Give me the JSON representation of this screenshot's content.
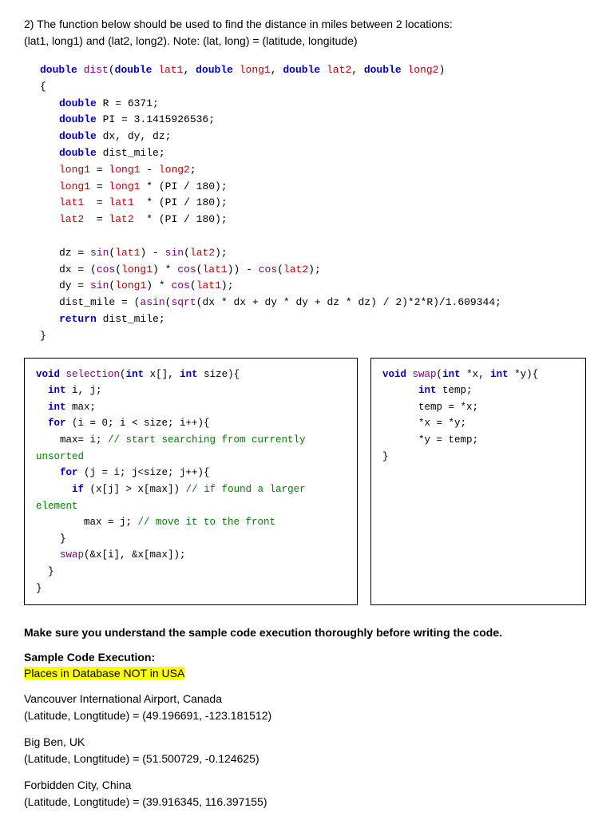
{
  "intro": {
    "number": "2)",
    "text": "  The function below should be used to find the distance in miles between 2 locations:",
    "note": "(lat1, long1) and (lat2, long2). Note: (lat, long) = (latitude, longitude)"
  },
  "dist_function": {
    "signature": "double dist(double lat1, double long1, double lat2, double long2)",
    "body_lines": [
      "double R = 6371;",
      "double PI = 3.1415926536;",
      "double dx, dy, dz;",
      "double dist_mile;",
      "long1 = long1 - long2;",
      "long1 = long1 * (PI / 180);",
      "lat1  = lat1  * (PI / 180);",
      "lat2  = lat2  * (PI / 180);",
      "",
      "dz = sin(lat1) - sin(lat2);",
      "dx = (cos(long1) * cos(lat1)) - cos(lat2);",
      "dy = sin(long1) * cos(lat1);",
      "dist_mile = (asin(sqrt(dx * dx + dy * dy + dz * dz) / 2)*2*R)/1.609344;",
      "return dist_mile;"
    ]
  },
  "selection_function": {
    "lines": [
      "void selection(int x[], int size){",
      "   int i, j;",
      "   int max;",
      "   for (i = 0; i < size; i++){",
      "      max= i; // start searching from currently unsorted",
      "      for (j = i; j<size; j++){",
      "         if (x[j] > x[max]) // if found a larger element",
      "            max = j; // move it to the front",
      "      }",
      "      swap(&x[i], &x[max]);",
      "   }",
      "}"
    ],
    "comment1": "// start searching from currently unsorted",
    "comment2": "// if found a larger element",
    "comment3": "// move it to the front"
  },
  "swap_function": {
    "lines": [
      "void swap(int *x, int *y){",
      "      int temp;",
      "      temp = *x;",
      "      *x = *y;",
      "      *y = temp;",
      "}"
    ]
  },
  "instruction": "Make sure you understand the sample code execution thoroughly before writing the code.",
  "sample_label": "Sample Code Execution:",
  "highlighted_text": "Places in Database NOT in USA",
  "places": [
    {
      "name": "Vancouver International Airport, Canada",
      "coords": "(Latitude, Longtitude) = (49.196691, -123.181512)"
    },
    {
      "name": "Big Ben, UK",
      "coords": "(Latitude, Longtitude) = (51.500729, -0.124625)"
    },
    {
      "name": "Forbidden City, China",
      "coords": "(Latitude, Longtitude) = (39.916345, 116.397155)"
    }
  ]
}
